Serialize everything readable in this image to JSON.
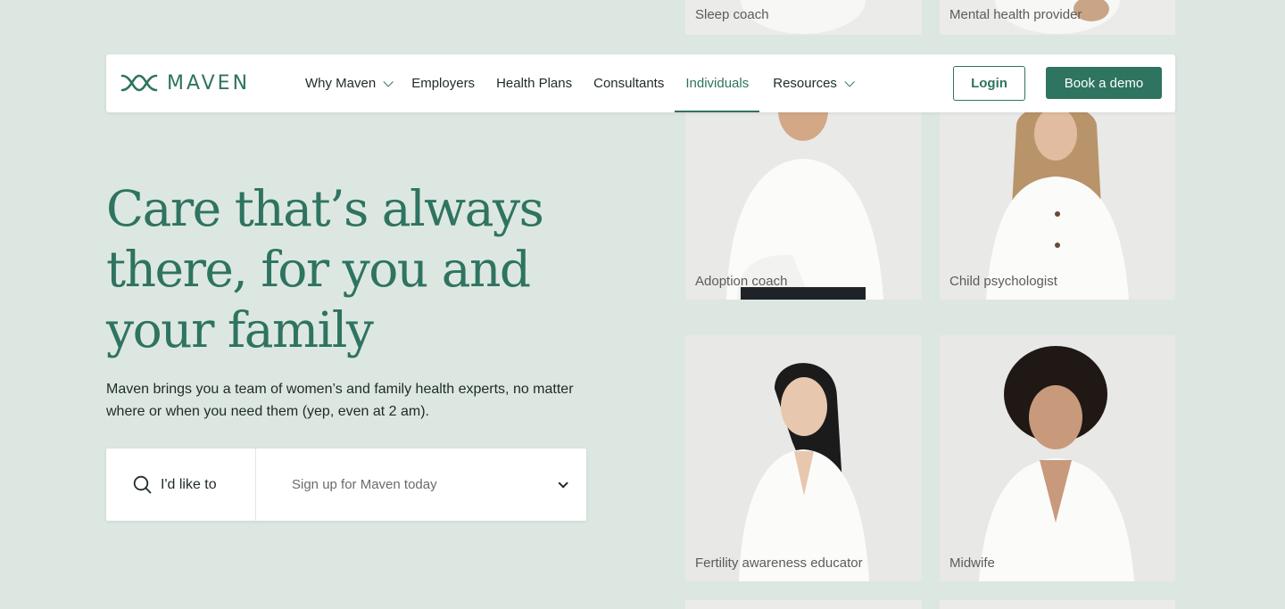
{
  "brand": {
    "name": "MAVEN",
    "color": "#2e7460"
  },
  "nav": {
    "links": [
      {
        "label": "Why Maven",
        "has_dropdown": true,
        "active": false
      },
      {
        "label": "Employers",
        "has_dropdown": false,
        "active": false
      },
      {
        "label": "Health Plans",
        "has_dropdown": false,
        "active": false
      },
      {
        "label": "Consultants",
        "has_dropdown": false,
        "active": false
      },
      {
        "label": "Individuals",
        "has_dropdown": false,
        "active": true
      },
      {
        "label": "Resources",
        "has_dropdown": true,
        "active": false
      }
    ],
    "login_label": "Login",
    "demo_label": "Book a demo"
  },
  "hero": {
    "title_line1": "Care that’s always",
    "title_line2": "there, for you and",
    "title_line3": "your family",
    "subtitle": "Maven brings you a team of women’s and family health experts, no matter where or when you need them (yep, even at 2 am)."
  },
  "selector": {
    "icon": "search-icon",
    "label": "I'd like to",
    "value": "Sign up for Maven today"
  },
  "providers": {
    "top_row": [
      "Sleep coach",
      "Mental health provider"
    ],
    "row2": [
      "Adoption coach",
      "Child psychologist"
    ],
    "row3": [
      "Fertility awareness educator",
      "Midwife"
    ]
  }
}
